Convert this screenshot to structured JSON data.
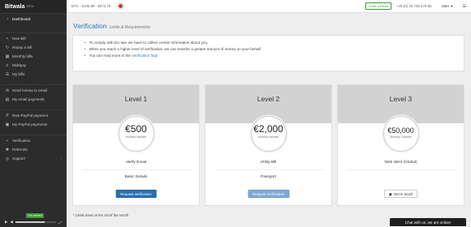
{
  "brand": {
    "name": "Bitwala",
    "badge": "BETA"
  },
  "sidebar": {
    "groups": [
      [
        {
          "label": "Dashboard",
          "icon": "gauge-icon"
        }
      ],
      [
        {
          "label": "New Bill",
          "icon": "plus-icon"
        },
        {
          "label": "Repay a bill",
          "icon": "refresh-icon"
        },
        {
          "label": "Monthly bills",
          "icon": "calendar-icon"
        },
        {
          "label": "Multipay",
          "icon": "layers-icon"
        },
        {
          "label": "My bills",
          "icon": "list-icon"
        }
      ],
      [
        {
          "label": "Send money to email",
          "icon": "envelope-icon"
        },
        {
          "label": "My email payments",
          "icon": "inbox-icon"
        }
      ],
      [
        {
          "label": "New PayPal payment",
          "icon": "paypal-icon"
        },
        {
          "label": "My PayPal payments",
          "icon": "wallet-icon"
        }
      ],
      [
        {
          "label": "Verification",
          "icon": "check-icon"
        },
        {
          "label": "Referrals",
          "icon": "gift-icon"
        },
        {
          "label": "Support",
          "icon": "lifebuoy-icon",
          "chevron": true
        }
      ]
    ],
    "verified_badge": "Get verified",
    "player_progress": 0.72
  },
  "topbar": {
    "ticker": "BTC - €345.88 - $372.79",
    "invite_label": "Invite a friend",
    "phone": "+49 (0) 30 749 279 85",
    "user_label": "User"
  },
  "page": {
    "title": "Verification",
    "subtitle": "Limits & Requirements",
    "info": [
      "To comply with EU law, we have to collect certain information about you.",
      "When you reach a higher level of verification, we can transfer a greater amount of money on your behalf.",
      "You can read more in the"
    ],
    "info_link": "verification faqs"
  },
  "levels": [
    {
      "title": "Level 1",
      "amount": "€500",
      "limit": "Monthly transfer",
      "req1": "Verify Email",
      "req2": "Basic Details",
      "button": "Request verification"
    },
    {
      "title": "Level 2",
      "amount": "€2,000",
      "limit": "Monthly transfer",
      "req1": "Utility Bill",
      "req2": "Passport",
      "button": "Request Verification"
    },
    {
      "title": "Level 3",
      "amount": "€50,000",
      "limit": "Monthly Transfer",
      "req1": "Web Ident (Global)",
      "req2": "",
      "button": "Get in touch"
    }
  ],
  "footnote": "* Limits reset on the 1st of the month",
  "chat": "Chat with us, we are online!",
  "colors": {
    "accent": "#2a7ab8",
    "sidebar": "#2c2c2c",
    "success": "#3a9b35"
  }
}
